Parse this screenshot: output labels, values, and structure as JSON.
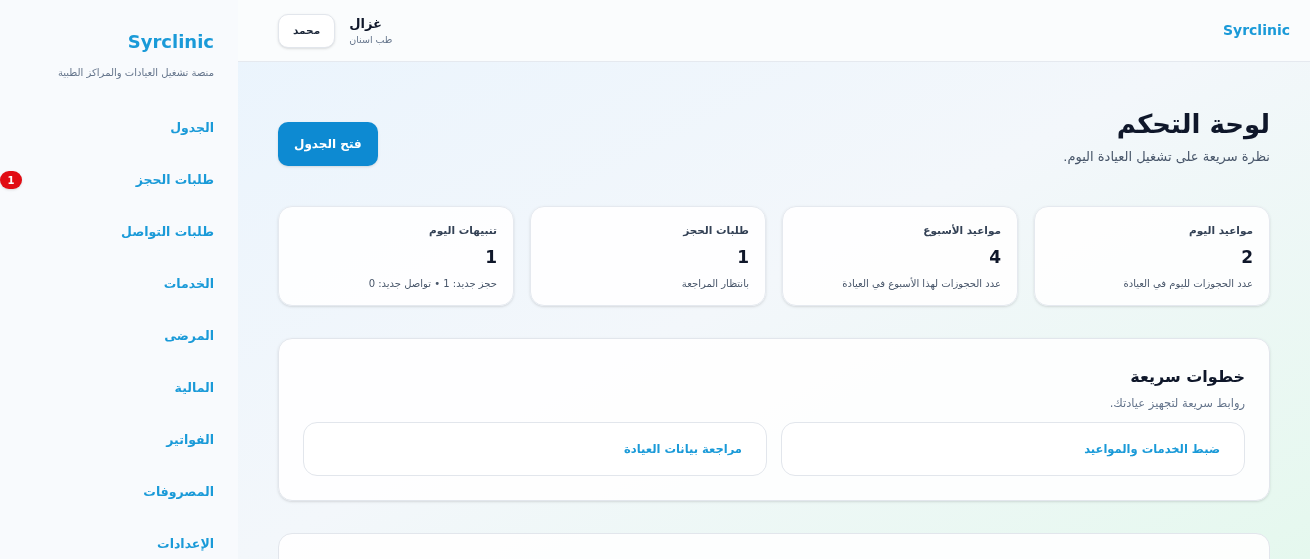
{
  "sidebar": {
    "brand": "Syrclinic",
    "tagline": "منصة تشغيل العيادات والمراكز الطبية",
    "items": [
      {
        "label": "الجدول"
      },
      {
        "label": "طلبات الحجز",
        "badge": "1"
      },
      {
        "label": "طلبات التواصل"
      },
      {
        "label": "الخدمات"
      },
      {
        "label": "المرضى"
      },
      {
        "label": "المالية"
      },
      {
        "label": "الفواتير"
      },
      {
        "label": "المصروفات"
      },
      {
        "label": "الإعدادات"
      }
    ]
  },
  "topbar": {
    "brand": "Syrclinic",
    "user": {
      "name": "غزال",
      "specialty": "طب اسنان",
      "button": "محمد"
    }
  },
  "header": {
    "title": "لوحة التحكم",
    "subtitle": "نظرة سريعة على تشغيل العيادة اليوم.",
    "action": "فتح الجدول"
  },
  "stats": [
    {
      "title": "مواعيد اليوم",
      "value": "2",
      "note": "عدد الحجوزات لليوم في العيادة"
    },
    {
      "title": "مواعيد الأسبوع",
      "value": "4",
      "note": "عدد الحجوزات لهذا الأسبوع في العيادة"
    },
    {
      "title": "طلبات الحجز",
      "value": "1",
      "note": "بانتظار المراجعة"
    },
    {
      "title": "تنبيهات اليوم",
      "value": "1",
      "note": "حجز جديد: 1 • تواصل جديد: 0"
    }
  ],
  "quick_steps": {
    "title": "خطوات سريعة",
    "subtitle": "روابط سريعة لتجهيز عيادتك.",
    "links": [
      "ضبط الخدمات والمواعيد",
      "مراجعة بيانات العيادة"
    ]
  }
}
